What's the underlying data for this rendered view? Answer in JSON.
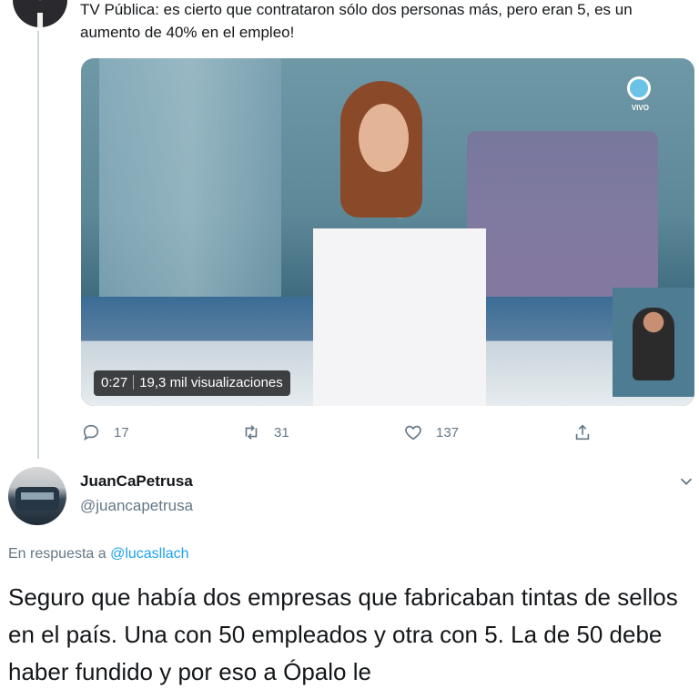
{
  "tweet": {
    "text": "TV Pública: es cierto que contrataron sólo dos personas más, pero eran 5, es un aumento de 40% en el empleo!",
    "media": {
      "duration": "0:27",
      "views": "19,3 mil visualizaciones",
      "channel_badge": "VIVO"
    },
    "actions": {
      "reply_count": "17",
      "retweet_count": "31",
      "like_count": "137"
    }
  },
  "reply": {
    "name": "JuanCaPetrusa",
    "handle": "@juancapetrusa",
    "reply_to_label": "En respuesta a",
    "reply_to_handle": "@lucasllach",
    "text": "Seguro que había dos empresas que fabricaban tintas de sellos en el país. Una con 50 empleados y otra con 5. La de 50 debe haber fundido y por eso a Ópalo le"
  },
  "icons": {
    "reply": "reply-icon",
    "retweet": "retweet-icon",
    "like": "heart-icon",
    "share": "share-icon",
    "more": "chevron-down-icon"
  },
  "colors": {
    "text": "#14171a",
    "secondary": "#657786",
    "link": "#1da1f2",
    "thread_line": "#ccd6dd"
  }
}
